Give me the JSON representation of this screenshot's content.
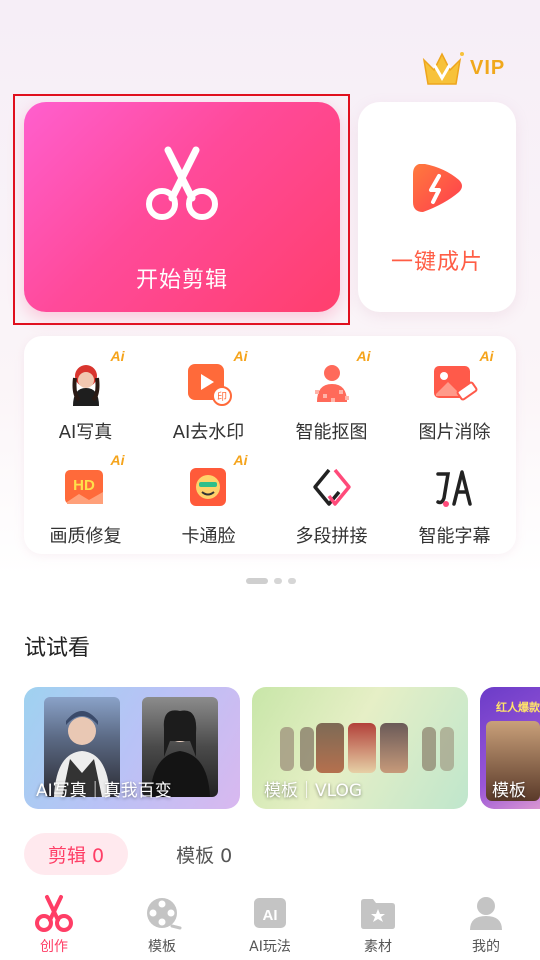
{
  "header": {
    "vip_label": "VIP"
  },
  "main_actions": {
    "start_edit_label": "开始剪辑",
    "one_click_label": "一键成片"
  },
  "tools": [
    {
      "label": "AI写真",
      "badge": "Ai",
      "icon": "portrait-icon"
    },
    {
      "label": "AI去水印",
      "badge": "Ai",
      "icon": "watermark-remove-icon"
    },
    {
      "label": "智能抠图",
      "badge": "Ai",
      "icon": "cutout-icon"
    },
    {
      "label": "图片消除",
      "badge": "Ai",
      "icon": "image-erase-icon"
    },
    {
      "label": "画质修复",
      "badge": "Ai",
      "icon": "hd-icon"
    },
    {
      "label": "卡通脸",
      "badge": "Ai",
      "icon": "cartoon-face-icon"
    },
    {
      "label": "多段拼接",
      "badge": "",
      "icon": "splice-icon"
    },
    {
      "label": "智能字幕",
      "badge": "",
      "icon": "subtitle-icon"
    }
  ],
  "try_section": {
    "title": "试试看",
    "cards": [
      {
        "caption": "AI写真｜真我百变"
      },
      {
        "caption": "模板｜VLOG"
      },
      {
        "caption": "模板",
        "headline": "红人爆款"
      }
    ]
  },
  "project_tabs": {
    "active": "剪辑 0",
    "other": "模板 0"
  },
  "bottom_nav": [
    {
      "label": "创作",
      "icon": "scissors-icon",
      "active": true
    },
    {
      "label": "模板",
      "icon": "film-reel-icon",
      "active": false
    },
    {
      "label": "AI玩法",
      "icon": "ai-icon",
      "active": false
    },
    {
      "label": "素材",
      "icon": "folder-icon",
      "active": false
    },
    {
      "label": "我的",
      "icon": "user-icon",
      "active": false
    }
  ],
  "colors": {
    "brand_pink": "#ff3e66",
    "orange": "#ff5d45",
    "gold": "#f5a41c"
  }
}
